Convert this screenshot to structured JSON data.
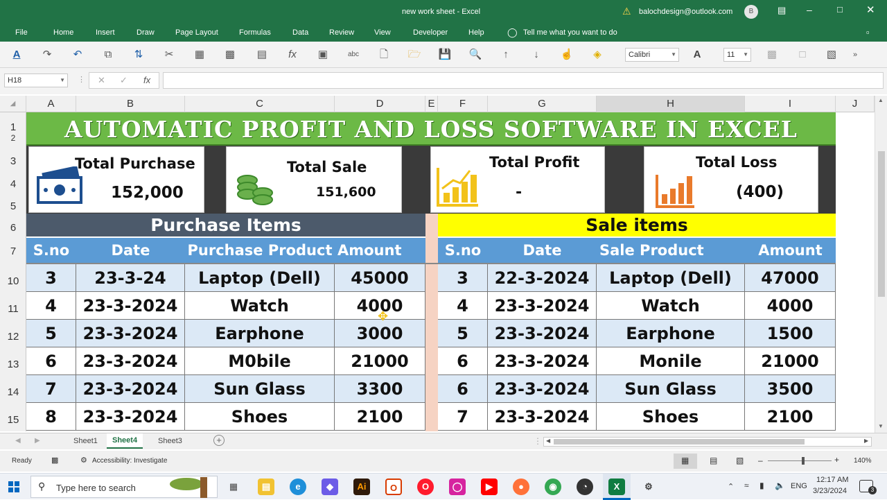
{
  "window": {
    "title": "new work sheet  -  Excel",
    "account": "balochdesign@outlook.com",
    "avatar_initial": "B"
  },
  "ribbon_tabs": [
    "File",
    "Home",
    "Insert",
    "Draw",
    "Page Layout",
    "Formulas",
    "Data",
    "Review",
    "View",
    "Developer",
    "Help"
  ],
  "tell_me": "Tell me what you want to do",
  "toolbar": {
    "font_name": "Calibri",
    "font_size": "11",
    "font_color_icon": "A"
  },
  "formula_bar": {
    "name_box": "H18",
    "fx": "fx",
    "content": ""
  },
  "columns": [
    "A",
    "B",
    "C",
    "D",
    "E",
    "F",
    "G",
    "H",
    "I",
    "J"
  ],
  "rows": [
    "1",
    "2",
    "3",
    "4",
    "5",
    "6",
    "7",
    "10",
    "11",
    "12",
    "13",
    "14",
    "15"
  ],
  "sheet": {
    "title": "AUTOMATIC PROFIT AND LOSS SOFTWARE IN EXCEL",
    "cards": [
      {
        "label": "Total Purchase",
        "value": "152,000",
        "icon": "money-icon"
      },
      {
        "label": "Total Sale",
        "value": "151,600",
        "icon": "coins-icon"
      },
      {
        "label": "Total Profit",
        "value": "-",
        "icon": "bar-chart-gold-icon"
      },
      {
        "label": "Total Loss",
        "value": "(400)",
        "icon": "bar-chart-orange-icon"
      }
    ],
    "purchase": {
      "title": "Purchase Items",
      "headers": [
        "S.no",
        "Date",
        "Purchase Product",
        "Amount"
      ],
      "rows": [
        [
          "3",
          "23-3-24",
          "Laptop (Dell)",
          "45000"
        ],
        [
          "4",
          "23-3-2024",
          "Watch",
          "4000"
        ],
        [
          "5",
          "23-3-2024",
          "Earphone",
          "3000"
        ],
        [
          "6",
          "23-3-2024",
          "M0bile",
          "21000"
        ],
        [
          "7",
          "23-3-2024",
          "Sun Glass",
          "3300"
        ],
        [
          "8",
          "23-3-2024",
          "Shoes",
          "2100"
        ]
      ]
    },
    "sale": {
      "title": "Sale items",
      "headers": [
        "S.no",
        "Date",
        "Sale Product",
        "Amount"
      ],
      "rows": [
        [
          "3",
          "22-3-2024",
          "Laptop (Dell)",
          "47000"
        ],
        [
          "4",
          "23-3-2024",
          "Watch",
          "4000"
        ],
        [
          "5",
          "23-3-2024",
          "Earphone",
          "1500"
        ],
        [
          "6",
          "23-3-2024",
          "Monile",
          "21000"
        ],
        [
          "6",
          "23-3-2024",
          "Sun Glass",
          "3500"
        ],
        [
          "7",
          "23-3-2024",
          "Shoes",
          "2100"
        ]
      ]
    }
  },
  "sheet_tabs": [
    "Sheet1",
    "Sheet4",
    "Sheet3"
  ],
  "active_sheet": "Sheet4",
  "status": {
    "ready": "Ready",
    "accessibility": "Accessibility: Investigate",
    "zoom": "140%"
  },
  "taskbar": {
    "search_placeholder": "Type here to search",
    "time": "12:17 AM",
    "date": "3/23/2024",
    "lang": "ENG",
    "notif_count": "3"
  },
  "colors": {
    "excel_green": "#217346",
    "title_band": "#6cb946",
    "purchase_header": "#4c5a6b",
    "sale_header": "#ffff00",
    "col_header_blue": "#5b9bd5",
    "row_light": "#dce9f6",
    "row_white": "#ffffff",
    "card_gap": "#3a3a3a"
  }
}
